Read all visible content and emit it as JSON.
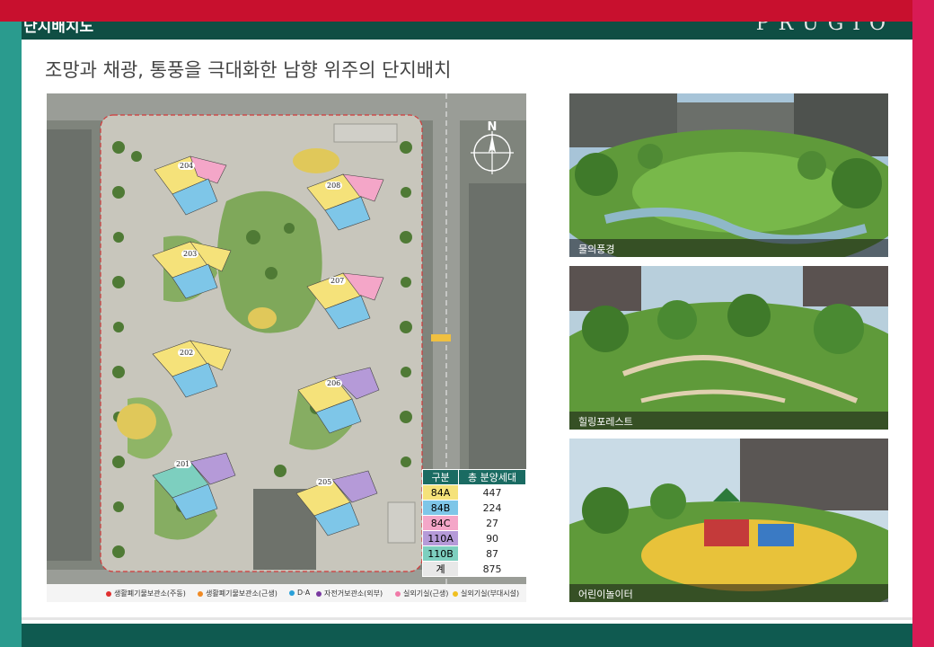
{
  "header": {
    "title": "단지배치도",
    "brand": "PRUGIO"
  },
  "headline": "조망과 채광, 통풍을 극대화한 남향 위주의 단지배치",
  "site_map": {
    "compass_label": "N",
    "buildings": [
      "204",
      "208",
      "203",
      "207",
      "202",
      "206",
      "201",
      "205"
    ],
    "unit_table": {
      "headers": [
        "구분",
        "총 분양세대"
      ],
      "rows": [
        {
          "type": "84A",
          "count": "447",
          "color": "#f5e27a"
        },
        {
          "type": "84B",
          "count": "224",
          "color": "#7ec6e8"
        },
        {
          "type": "84C",
          "count": "27",
          "color": "#f4a6c8"
        },
        {
          "type": "110A",
          "count": "90",
          "color": "#b59ad8"
        },
        {
          "type": "110B",
          "count": "87",
          "color": "#7dcfbf"
        },
        {
          "type": "계",
          "count": "875",
          "color": "#e8e8e8"
        }
      ]
    },
    "legend": [
      {
        "label": "생활폐기물보관소(주동)",
        "color": "#e03030"
      },
      {
        "label": "생활폐기물보관소(근생)",
        "color": "#f08a24"
      },
      {
        "label": "D·A",
        "color": "#2aa0d8"
      },
      {
        "label": "자전거보관소(외부)",
        "color": "#7a3aa0"
      },
      {
        "label": "실외기실(근생)",
        "color": "#f07aa8"
      },
      {
        "label": "실외기실(부대시설)",
        "color": "#f0c020"
      }
    ]
  },
  "photos": [
    {
      "caption": "물의풍경"
    },
    {
      "caption": "힐링포레스트"
    },
    {
      "caption": "어린이놀이터"
    }
  ]
}
